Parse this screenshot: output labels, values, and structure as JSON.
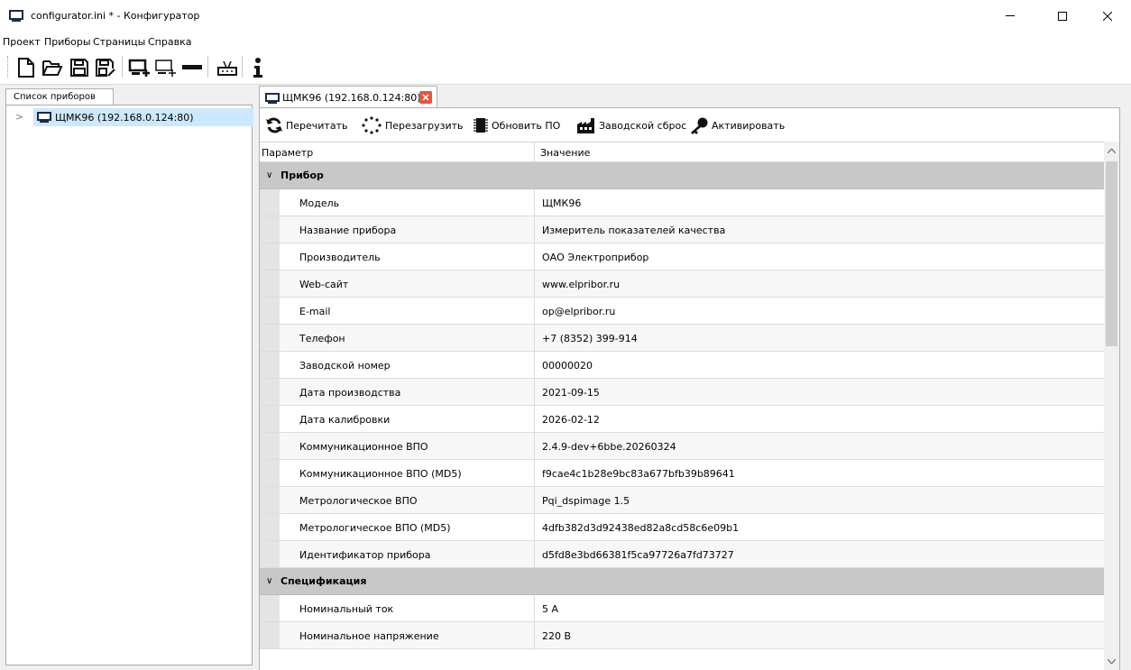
{
  "window": {
    "title": "configurator.ini * - Конфигуратор"
  },
  "menu": [
    "Проект",
    "Приборы",
    "Страницы",
    "Справка"
  ],
  "toolbar": {
    "buttons": [
      "new-file-icon",
      "open-folder-icon",
      "save-icon",
      "save-as-icon",
      "add-device-icon",
      "add-device-alt-icon",
      "remove-icon",
      "connection-icon",
      "info-icon"
    ]
  },
  "left_panel": {
    "tab_label": "Список приборов",
    "tree": [
      {
        "label": "ЩМК96 (192.168.0.124:80)",
        "icon": "device-icon",
        "selected": true
      }
    ]
  },
  "right_panel": {
    "tab_label": "ЩМК96 (192.168.0.124:80)",
    "actions": [
      {
        "label": "Перечитать",
        "icon": "refresh-icon"
      },
      {
        "label": "Перезагрузить",
        "icon": "reboot-icon"
      },
      {
        "label": "Обновить ПО",
        "icon": "chip-icon"
      },
      {
        "label": "Заводской сброс",
        "icon": "factory-icon"
      },
      {
        "label": "Активировать",
        "icon": "key-icon"
      }
    ],
    "columns": [
      "Параметр",
      "Значение"
    ],
    "groups": [
      {
        "name": "Прибор",
        "rows": [
          {
            "param": "Модель",
            "value": "ЩМК96"
          },
          {
            "param": "Название прибора",
            "value": "Измеритель показателей качества"
          },
          {
            "param": "Производитель",
            "value": "ОАО Электроприбор"
          },
          {
            "param": "Web-сайт",
            "value": "www.elpribor.ru"
          },
          {
            "param": "E-mail",
            "value": "op@elpribor.ru"
          },
          {
            "param": "Телефон",
            "value": "+7 (8352) 399-914"
          },
          {
            "param": "Заводской номер",
            "value": "00000020"
          },
          {
            "param": "Дата производства",
            "value": "2021-09-15"
          },
          {
            "param": "Дата калибровки",
            "value": "2026-02-12"
          },
          {
            "param": "Коммуникационное ВПО",
            "value": "2.4.9-dev+6bbe.20260324"
          },
          {
            "param": "Коммуникационное ВПО (MD5)",
            "value": "f9cae4c1b28e9bc83a677bfb39b89641"
          },
          {
            "param": "Метрологическое ВПО",
            "value": "Pqi_dspimage 1.5"
          },
          {
            "param": "Метрологическое ВПО (MD5)",
            "value": "4dfb382d3d92438ed82a8cd58c6e09b1"
          },
          {
            "param": "Идентификатор прибора",
            "value": "d5fd8e3bd66381f5ca97726a7fd73727"
          }
        ]
      },
      {
        "name": "Спецификация",
        "rows": [
          {
            "param": "Номинальный ток",
            "value": "5 А"
          },
          {
            "param": "Номинальное напряжение",
            "value": "220 В"
          }
        ]
      }
    ]
  },
  "colors": {
    "selection": "#cce8ff",
    "group_bg": "#c8c8c8",
    "close_tab": "#e8553b"
  }
}
